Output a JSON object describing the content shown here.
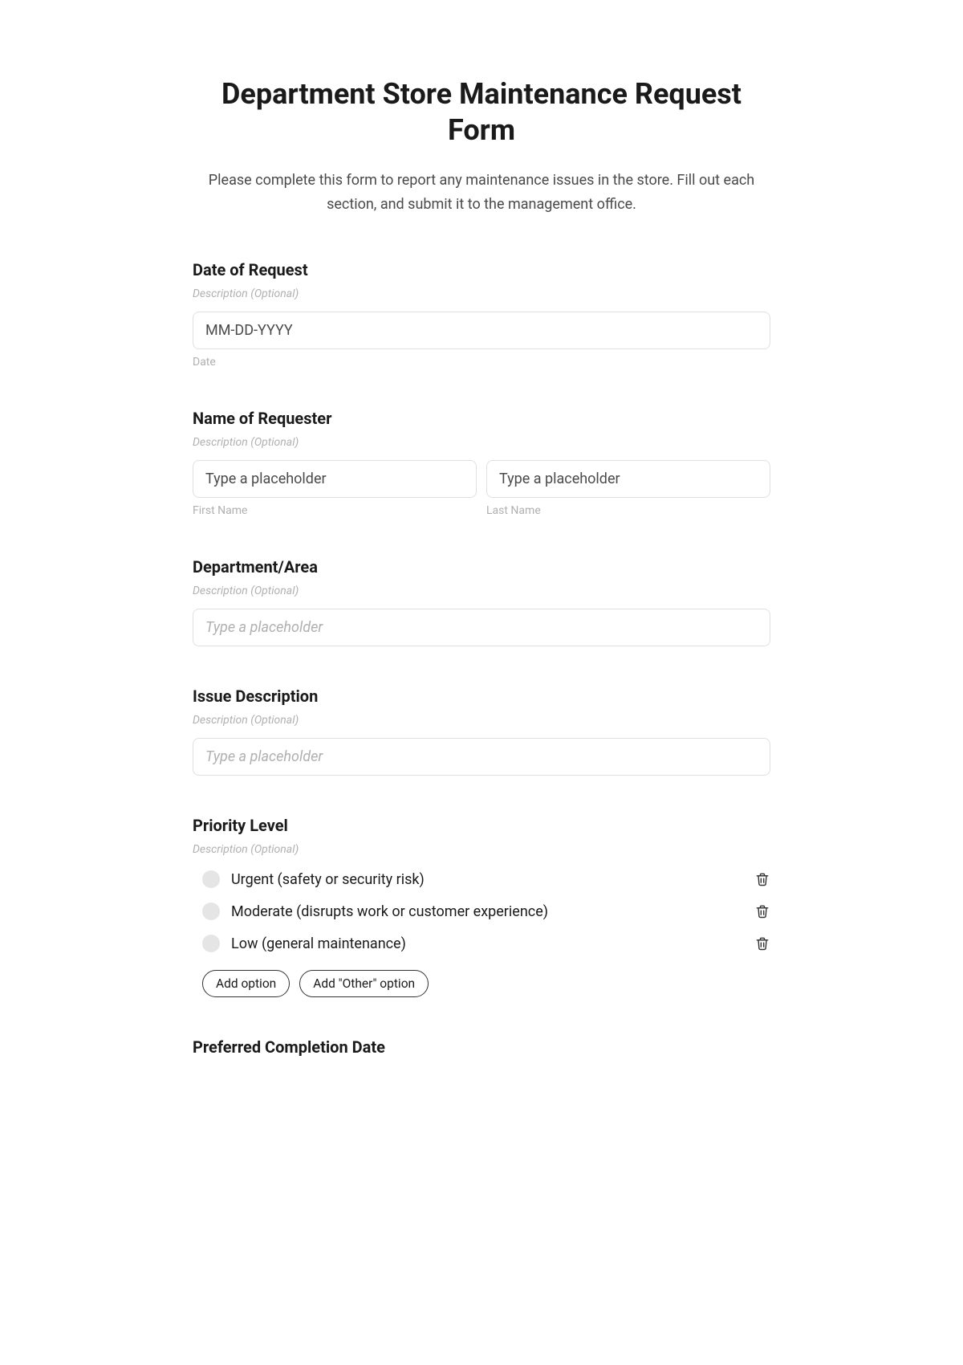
{
  "form": {
    "title": "Department Store Maintenance Request Form",
    "intro": "Please complete this form to report any maintenance issues in the store. Fill out each section, and submit it to the management office.",
    "description_placeholder": "Description (Optional)"
  },
  "dateOfRequest": {
    "label": "Date of Request",
    "placeholder": "MM-DD-YYYY",
    "subLabel": "Date"
  },
  "requesterName": {
    "label": "Name of Requester",
    "placeholder": "Type a placeholder",
    "firstNameLabel": "First Name",
    "lastNameLabel": "Last Name"
  },
  "departmentArea": {
    "label": "Department/Area",
    "placeholder": "Type a placeholder"
  },
  "issueDescription": {
    "label": "Issue Description",
    "placeholder": "Type a placeholder"
  },
  "priorityLevel": {
    "label": "Priority Level",
    "options": [
      "Urgent (safety or security risk)",
      "Moderate (disrupts work or customer experience)",
      "Low (general maintenance)"
    ],
    "addOption": "Add option",
    "addOther": "Add \"Other\" option"
  },
  "preferredCompletion": {
    "label": "Preferred Completion Date"
  }
}
